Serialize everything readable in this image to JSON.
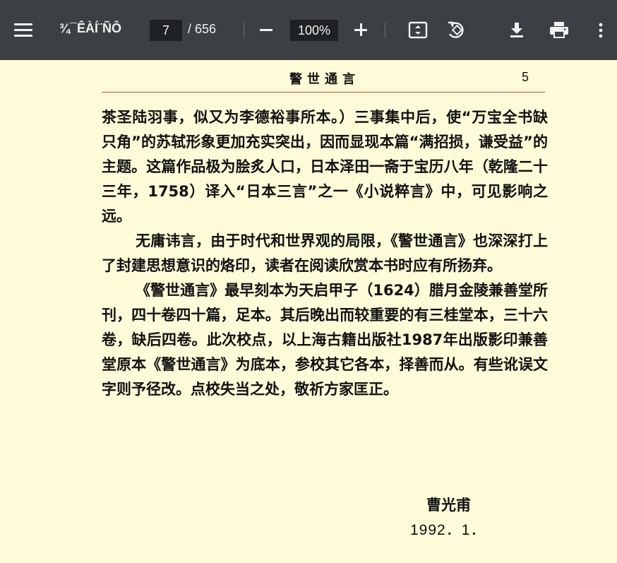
{
  "toolbar": {
    "menu_icon": "menu-icon",
    "doc_title": "¾¯ÊÀÍ¨ÑÔ",
    "current_page": "7",
    "total_pages": "/ 656",
    "zoom": "100%",
    "icons": [
      "minus-icon",
      "plus-icon",
      "fit-page-icon",
      "rotate-icon",
      "download-icon",
      "print-icon",
      "more-vert-icon"
    ]
  },
  "page": {
    "header_title": "警世通言",
    "page_number": "5",
    "paragraphs": [
      "茶圣陆羽事，似又为李德裕事所本。）三事集中后，使“万宝全书缺只角”的苏轼形象更加充实突出，因而显现本篇“满招损，谦受益”的主题。这篇作品极为脍炙人口，日本泽田一斋于宝历八年（乾隆二十三年，1758）译入“日本三言”之一《小说粹言》中，可见影响之远。",
      "无庸讳言，由于时代和世界观的局限，《警世通言》也深深打上了封建思想意识的烙印，读者在阅读欣赏本书时应有所扬弃。",
      "《警世通言》最早刻本为天启甲子（1624）腊月金陵兼善堂所刊，四十卷四十篇，足本。其后晚出而较重要的有三桂堂本，三十六卷，缺后四卷。此次校点，以上海古籍出版社1987年出版影印兼善堂原本《警世通言》为底本，参校其它各本，择善而从。有些讹误文字则予径改。点校失当之处，敬祈方家匡正。"
    ],
    "author": "曹光甫",
    "date": "1992．1．"
  },
  "colors": {
    "toolbar_bg": "#3c3f43",
    "page_bg": "#fefbd8",
    "rule": "#c04a3c"
  }
}
